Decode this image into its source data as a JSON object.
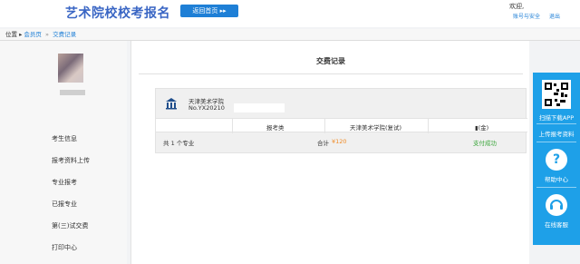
{
  "header": {
    "site_title": "艺术院校校考报名",
    "top_button": "返回首页 ▸▸",
    "welcome": "欢迎,",
    "links": [
      "账号与安全",
      "退出"
    ]
  },
  "breadcrumb": {
    "prefix": "位置 ▸",
    "home": "会员页",
    "sep": "»",
    "current": "交费记录"
  },
  "sidebar": {
    "items": [
      "考生信息",
      "报考资料上传",
      "专业报考",
      "已报专业",
      "第(三)试交费",
      "打印中心"
    ]
  },
  "main": {
    "title": "交费记录",
    "school_name": "天津美术学院",
    "order_no": "No.YX20210",
    "table_headers": [
      "报考类",
      "天津美术学院(复试)",
      "▮(金)"
    ],
    "row": {
      "count": "共 1 个专业",
      "total_label": "合计",
      "total_value": "¥120",
      "status": "支付成功"
    }
  },
  "rightbar": {
    "items": [
      "扫描下载APP",
      "上传报考资料",
      "帮助中心",
      "在线客服"
    ]
  }
}
